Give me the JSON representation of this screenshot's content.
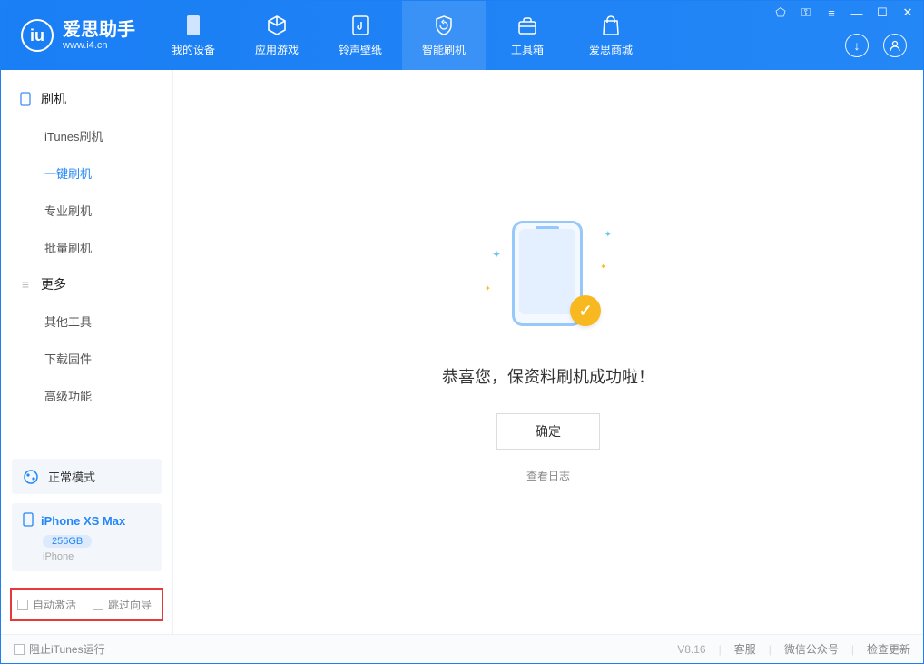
{
  "app": {
    "name_cn": "爱思助手",
    "url": "www.i4.cn"
  },
  "tabs": [
    {
      "label": "我的设备"
    },
    {
      "label": "应用游戏"
    },
    {
      "label": "铃声壁纸"
    },
    {
      "label": "智能刷机"
    },
    {
      "label": "工具箱"
    },
    {
      "label": "爱思商城"
    }
  ],
  "sidebar": {
    "group1": {
      "title": "刷机",
      "items": [
        "iTunes刷机",
        "一键刷机",
        "专业刷机",
        "批量刷机"
      ]
    },
    "group2": {
      "title": "更多",
      "items": [
        "其他工具",
        "下载固件",
        "高级功能"
      ]
    }
  },
  "mode": {
    "label": "正常模式"
  },
  "device": {
    "name": "iPhone XS Max",
    "capacity": "256GB",
    "type": "iPhone"
  },
  "checkboxes": {
    "auto_activate": "自动激活",
    "skip_guide": "跳过向导"
  },
  "main": {
    "success_title": "恭喜您，保资料刷机成功啦！",
    "ok": "确定",
    "view_log": "查看日志"
  },
  "footer": {
    "block_itunes": "阻止iTunes运行",
    "version": "V8.16",
    "link1": "客服",
    "link2": "微信公众号",
    "link3": "检查更新"
  }
}
